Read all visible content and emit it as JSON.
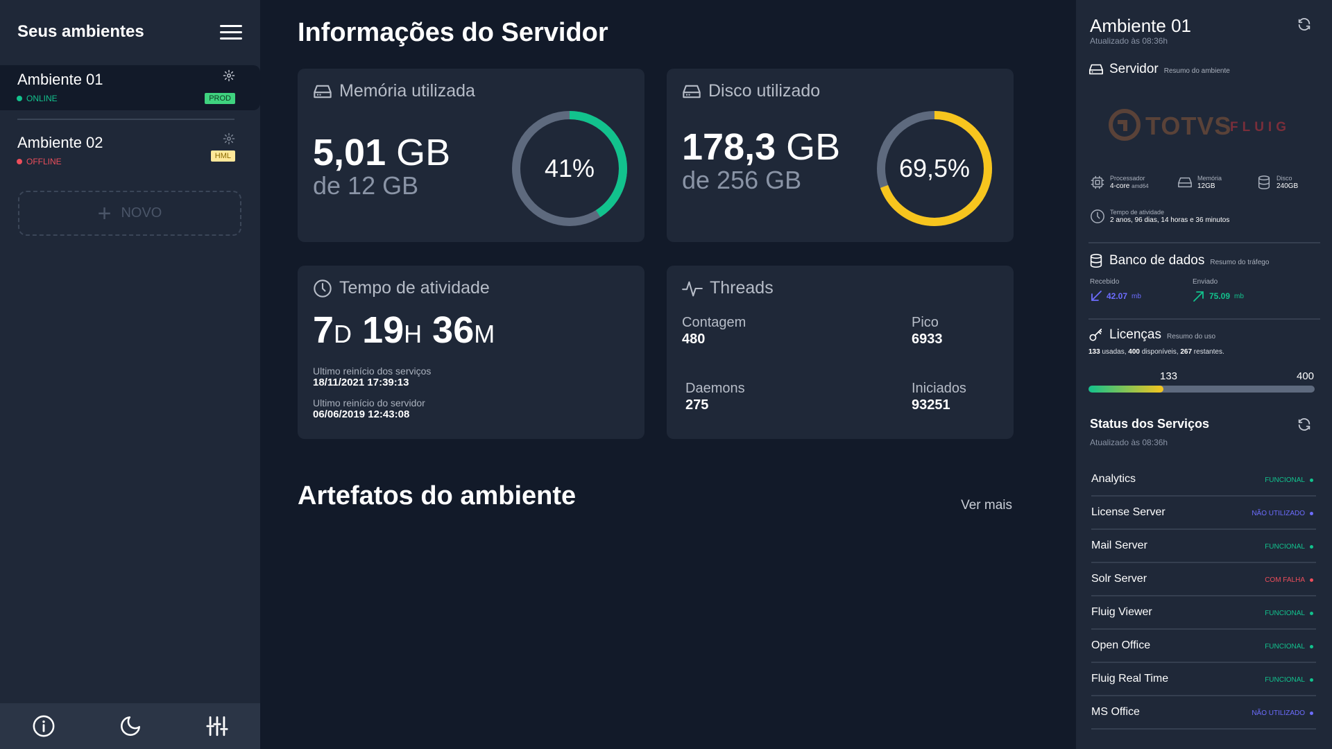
{
  "sidebar": {
    "title": "Seus ambientes",
    "environments": [
      {
        "name": "Ambiente 01",
        "status": "ONLINE",
        "status_color": "#12c28d",
        "badge": "PROD",
        "badge_bg": "#3fd37f",
        "badge_fg": "#0e3a22"
      },
      {
        "name": "Ambiente 02",
        "status": "OFFLINE",
        "status_color": "#ec4e5b",
        "badge": "HML",
        "badge_bg": "#ffe89a",
        "badge_fg": "#8a6a00"
      }
    ],
    "new_button": "NOVO",
    "footer_icons": [
      "info-icon",
      "moon-icon",
      "sliders-icon"
    ]
  },
  "main": {
    "title": "Informações do Servidor",
    "memory": {
      "label": "Memória utilizada",
      "value": "5,01",
      "unit": "GB",
      "total": "de 12 GB",
      "percent_label": "41%",
      "percent": 41,
      "color": "#12c28d"
    },
    "disk": {
      "label": "Disco utilizado",
      "value": "178,3",
      "unit": "GB",
      "total": "de 256 GB",
      "percent_label": "69,5%",
      "percent": 69.5,
      "color": "#f7c51e"
    },
    "uptime": {
      "label": "Tempo de atividade",
      "days": "7",
      "days_unit": "D",
      "hours": "19",
      "hours_unit": "H",
      "minutes": "36",
      "minutes_unit": "M",
      "services_restart_label": "Ultimo reinício dos serviços",
      "services_restart_value": "18/11/2021 17:39:13",
      "server_restart_label": "Ultimo reinício do servidor",
      "server_restart_value": "06/06/2019 12:43:08"
    },
    "threads": {
      "label": "Threads",
      "count_label": "Contagem",
      "count_value": "480",
      "peak_label": "Pico",
      "peak_value": "6933",
      "daemons_label": "Daemons",
      "daemons_value": "275",
      "started_label": "Iniciados",
      "started_value": "93251"
    },
    "artifacts_title": "Artefatos do ambiente",
    "see_more": "Ver mais"
  },
  "right_panel": {
    "title": "Ambiente 01",
    "updated": "Atualizado às 08:36h",
    "server": {
      "title": "Servidor",
      "subtitle": "Resumo do ambiente",
      "logo_text": "TOTVS",
      "logo_sub": "FLUIG",
      "processor_label": "Processador",
      "processor_value": "4-core",
      "processor_extra": "amd64",
      "memory_label": "Memória",
      "memory_value": "12GB",
      "disk_label": "Disco",
      "disk_value": "240GB",
      "uptime_label": "Tempo de atividade",
      "uptime_value": "2 anos, 96 dias, 14 horas e 36 minutos"
    },
    "database": {
      "title": "Banco de dados",
      "subtitle": "Resumo do tráfego",
      "received_label": "Recebido",
      "received_value": "42.07",
      "received_unit": "mb",
      "received_color": "#6d6dff",
      "sent_label": "Enviado",
      "sent_value": "75.09",
      "sent_unit": "mb",
      "sent_color": "#12c28d"
    },
    "licenses": {
      "title": "Licenças",
      "subtitle": "Resumo do uso",
      "used": "133",
      "used_text": " usadas, ",
      "available": "400",
      "available_text": " disponíveis, ",
      "remaining": "267",
      "remaining_text": " restantes.",
      "bar_used": 133,
      "bar_total": 400
    },
    "services": {
      "title": "Status dos Serviços",
      "updated": "Atualizado às 08:36h",
      "items": [
        {
          "name": "Analytics",
          "status": "FUNCIONAL",
          "color": "#12c28d"
        },
        {
          "name": "License Server",
          "status": "NÃO UTILIZADO",
          "color": "#6d6dff"
        },
        {
          "name": "Mail Server",
          "status": "FUNCIONAL",
          "color": "#12c28d"
        },
        {
          "name": "Solr Server",
          "status": "COM FALHA",
          "color": "#ec4e5b"
        },
        {
          "name": "Fluig Viewer",
          "status": "FUNCIONAL",
          "color": "#12c28d"
        },
        {
          "name": "Open Office",
          "status": "FUNCIONAL",
          "color": "#12c28d"
        },
        {
          "name": "Fluig Real Time",
          "status": "FUNCIONAL",
          "color": "#12c28d"
        },
        {
          "name": "MS Office",
          "status": "NÃO UTILIZADO",
          "color": "#6d6dff"
        }
      ]
    }
  }
}
